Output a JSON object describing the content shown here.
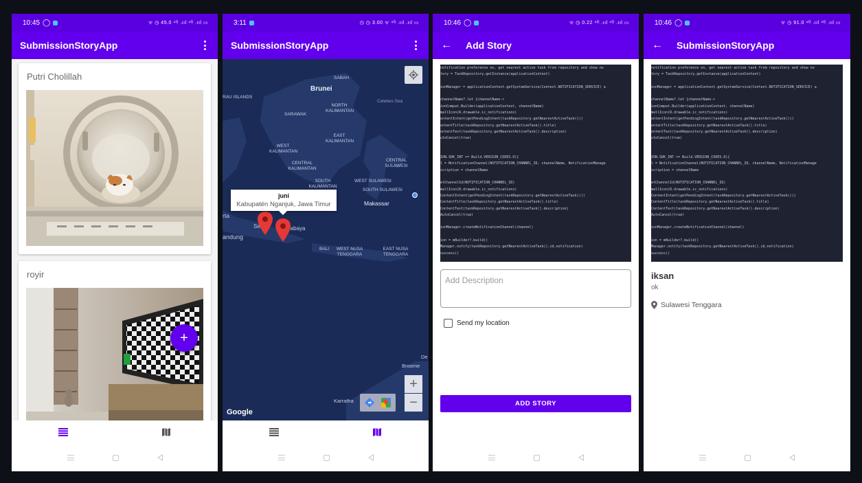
{
  "screens": [
    {
      "status_time": "10:45",
      "status_right": "ᯤ ◷ 45.0 ⁴ᴳ .ııl ⁴ᴳ .ııl ▭",
      "title": "SubmissionStoryApp",
      "stories": [
        {
          "name": "Putri Cholillah"
        },
        {
          "name": "royir"
        }
      ],
      "fab_label": "+"
    },
    {
      "status_time": "3:11",
      "status_right": "◷ ◷ 3.00 ᯤ ⁴ᴳ .ııl .ııl ▭",
      "title": "SubmissionStoryApp",
      "map": {
        "info_title": "juni",
        "info_subtitle": "Kabupatén Nganjuk, Jawa Timur",
        "google": "Google",
        "labels": {
          "sabah": "SABAH",
          "brunei": "Brunei",
          "islands": "RAU ISLANDS",
          "celebes": "Celebes Sea",
          "sarawak": "SARAWAK",
          "north_kal": "NORTH KALIMANTAN",
          "east_kal": "EAST KALIMANTAN",
          "west_kal": "WEST KALIMANTAN",
          "central_kal": "CENTRAL KALIMANTAN",
          "central_sul": "CENTRAL SULAWESI",
          "south_kal": "SOUTH KALIMANTAN",
          "west_sul": "WEST SULAWESI",
          "south_sul": "SOUTH SULAWESI",
          "makassar": "Makassar",
          "rta": "rta",
          "bandung": "andung",
          "semarang": "Sem",
          "surabaya": "rabaya",
          "bali": "BALI",
          "west_nusa": "WEST NUSA TENGGARA",
          "east_nusa": "EAST NUSA TENGGARA",
          "broome": "Broome",
          "de": "De",
          "karratha": "Karratha"
        }
      }
    },
    {
      "status_time": "10:46",
      "status_right": "ᯤ ◷ 0.22 ⁴ᴳ .ııl ⁴ᴳ .ııl ▭",
      "title": "Add Story",
      "description_placeholder": "Add Description",
      "checkbox_label": "Send my location",
      "button_label": "ADD STORY"
    },
    {
      "status_time": "10:46",
      "status_right": "ᯤ ◷ 91.0 ⁴ᴳ .ııl ⁴ᴳ .ııl ▭",
      "title": "SubmissionStoryApp",
      "detail_name": "iksan",
      "detail_desc": "ok",
      "detail_location": "Sulawesi Tenggara"
    }
  ],
  "code_lines": [
    " notification preference on, get nearest active task from repository and show no",
    "tory = TaskRepository.getInstance(applicationContext)",
    "",
    "ionManager = applicationContext.getSystemService(Context.NOTIFICATION_SERVICE) a",
    "",
    "channelName?.let {channelName->",
    "ionCompat.Builder(applicationContext, channelName)",
    "mallIcon(R.drawable.ic_notifications)",
    "ontentIntent(getPendingIntent(taskRepository.getNearestActiveTask()))",
    "ontentTitle(taskRepository.getNearestActiveTask().title)",
    "ontentText(taskRepository.getNearestActiveTask().description)",
    "utoCancel(true)",
    "",
    "",
    "ION.SDK_INT >= Build.VERSION_CODES.O){",
    "l = NotificationChannel(NOTIFICATION_CHANNEL_ID, channelName, NotificationManage",
    "scription = channelName",
    "",
    "etChannelId(NOTIFICATION_CHANNEL_ID)",
    "mallIcon(R.drawable.ic_notifications)",
    "ContentIntent(getPendingIntent(taskRepository.getNearestActiveTask()))",
    "ContentTitle(taskRepository.getNearestActiveTask().title)",
    "ContentText(taskRepository.getNearestActiveTask().description)",
    "AutoCancel(true)",
    "",
    "ionManager.createNotificationChannel(channel)",
    "",
    "ion = mBuilder?.build()",
    "Manager.notify(taskRepository.getNearestActiveTask().id,notification)",
    "success()"
  ]
}
